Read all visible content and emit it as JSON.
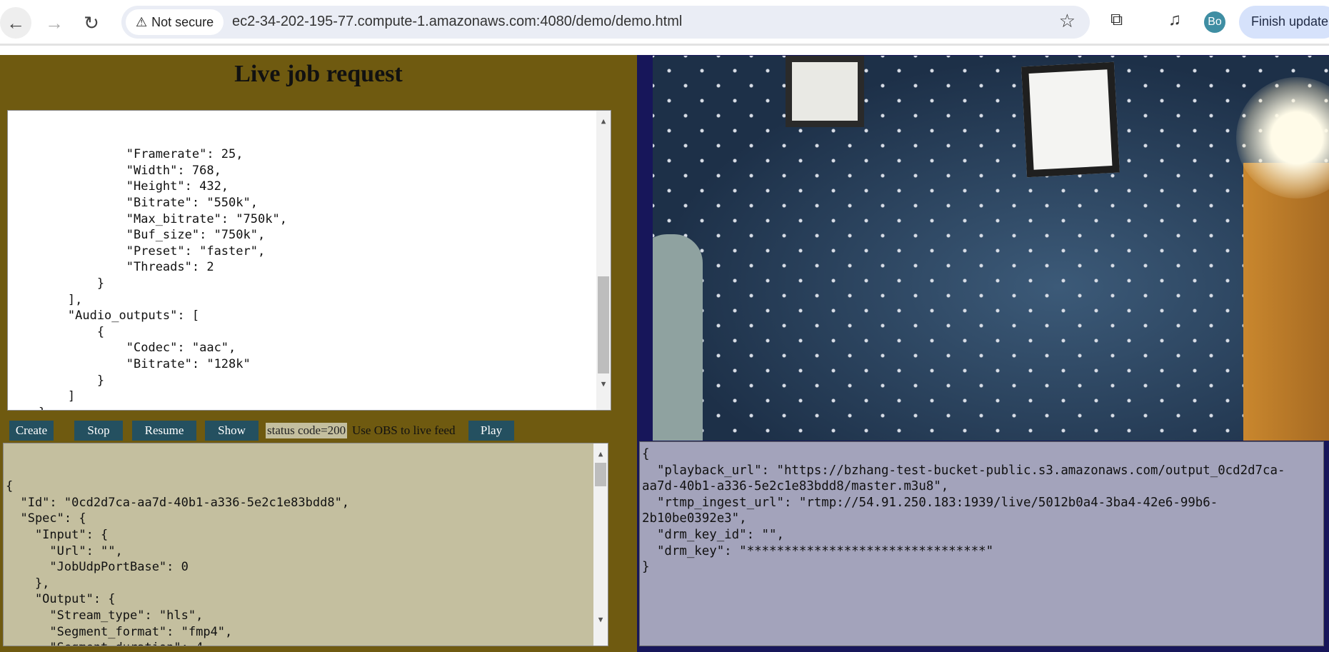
{
  "browser": {
    "security": "Not secure",
    "url": "ec2-34-202-195-77.compute-1.amazonaws.com:4080/demo/demo.html",
    "avatar": "Bo",
    "finish_update": "Finish update"
  },
  "page": {
    "title": "Live job request"
  },
  "request_lines": [
    "                \"Framerate\": 25,",
    "                \"Width\": 768,",
    "                \"Height\": 432,",
    "                \"Bitrate\": \"550k\",",
    "                \"Max_bitrate\": \"750k\",",
    "                \"Buf_size\": \"750k\",",
    "                \"Preset\": \"faster\",",
    "                \"Threads\": 2",
    "            }",
    "        ],",
    "        \"Audio_outputs\": [",
    "            {",
    "                \"Codec\": \"aac\",",
    "                \"Bitrate\": \"128k\"",
    "            }",
    "        ]",
    "    }",
    "}"
  ],
  "buttons": {
    "create": "Create",
    "stop": "Stop",
    "resume": "Resume",
    "show": "Show",
    "play": "Play"
  },
  "status": {
    "code": "status code=200",
    "hint": "Use OBS to live feed"
  },
  "response_lines": [
    "{",
    "  \"Id\": \"0cd2d7ca-aa7d-40b1-a336-5e2c1e83bdd8\",",
    "  \"Spec\": {",
    "    \"Input\": {",
    "      \"Url\": \"\",",
    "      \"JobUdpPortBase\": 0",
    "    },",
    "    \"Output\": {",
    "      \"Stream_type\": \"hls\",",
    "      \"Segment_format\": \"fmp4\",",
    "      \"Segment_duration\": 4,",
    "      \"Fragment_duration\": 1,"
  ],
  "playback_info": "{\n  \"playback_url\": \"https://bzhang-test-bucket-public.s3.amazonaws.com/output_0cd2d7ca-aa7d-40b1-a336-5e2c1e83bdd8/master.m3u8\",\n  \"rtmp_ingest_url\": \"rtmp://54.91.250.183:1939/live/5012b0a4-3ba4-42e6-99b6-2b10be0392e3\",\n  \"drm_key_id\": \"\",\n  \"drm_key\": \"********************************\"\n}",
  "colors": {
    "left_panel": "#6f5a10",
    "right_panel": "#17165a",
    "button": "#245060",
    "response_bg": "#c4bf9f",
    "playback_bg": "#a3a3bb"
  }
}
